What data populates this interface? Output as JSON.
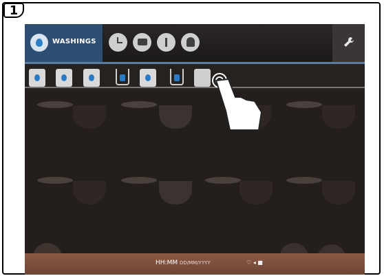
{
  "step": {
    "number": "1"
  },
  "header": {
    "washings_label": "WASHINGS"
  },
  "top_icons": [
    "clock-icon",
    "flag-icon",
    "info-icon",
    "person-icon"
  ],
  "beverage_icons": [
    "coffee-cup-icon",
    "cup-water-icon",
    "milk-jug-icon",
    "glass-water-icon",
    "pitcher-icon",
    "glass-icon",
    "teapot-icon"
  ],
  "status": {
    "time": "HH:MM",
    "date": "DD/MM/YYYY"
  },
  "colors": {
    "washings_tab": "#2d4e72",
    "screen_bg": "#241f1d",
    "status_bar": "#7a4d3c",
    "accent_line": "#5d7da0"
  }
}
